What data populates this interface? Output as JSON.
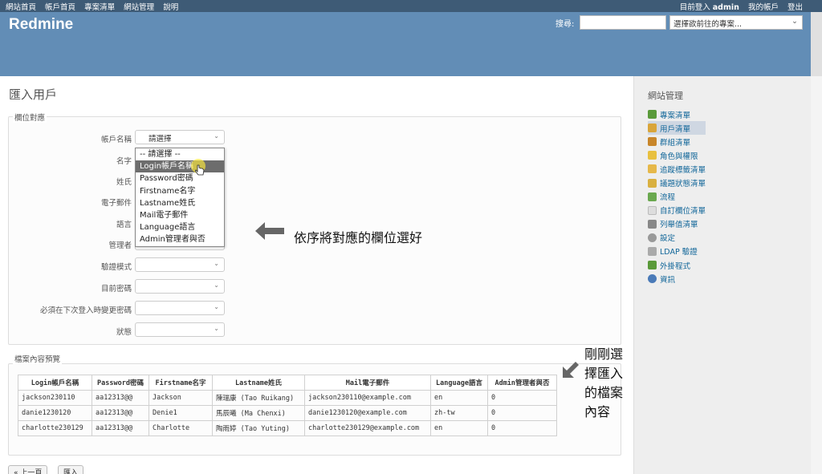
{
  "top_menu": {
    "left": [
      "網站首頁",
      "帳戶首頁",
      "專案清單",
      "網站管理",
      "說明"
    ],
    "logged_in_prefix": "目前登入",
    "user": "admin",
    "my_account": "我的帳戶",
    "logout": "登出"
  },
  "header": {
    "brand": "Redmine",
    "search_label": "搜尋:",
    "jump_placeholder": "選擇欲前往的專案..."
  },
  "page": {
    "title": "匯入用戶",
    "mapping_legend": "欄位對應",
    "preview_legend": "檔案內容預覽"
  },
  "fields": [
    {
      "label": "帳戶名稱",
      "value": "請選擇"
    },
    {
      "label": "名字",
      "value": ""
    },
    {
      "label": "姓氏",
      "value": ""
    },
    {
      "label": "電子郵件",
      "value": ""
    },
    {
      "label": "語言",
      "value": ""
    },
    {
      "label": "管理者",
      "value": ""
    },
    {
      "label": "驗證模式",
      "value": ""
    },
    {
      "label": "目前密碼",
      "value": ""
    },
    {
      "label": "必須在下次登入時變更密碼",
      "value": ""
    },
    {
      "label": "狀態",
      "value": ""
    }
  ],
  "dropdown_options": [
    "-- 請選擇 --",
    "Login帳戶名稱",
    "Password密碼",
    "Firstname名字",
    "Lastname姓氏",
    "Mail電子郵件",
    "Language語言",
    "Admin管理者與否"
  ],
  "dropdown_highlight": 1,
  "annotations": {
    "mapping_hint": "依序將對應的欄位選好",
    "preview_hint": "剛剛選擇匯入的檔案內容"
  },
  "preview": {
    "headers": [
      "Login帳戶名稱",
      "Password密碼",
      "Firstname名字",
      "Lastname姓氏",
      "Mail電子郵件",
      "Language語言",
      "Admin管理者與否"
    ],
    "rows": [
      [
        "jackson230110",
        "aa12313@@",
        "Jackson",
        "陳瑞康 (Tao Ruikang)",
        "jackson230110@example.com",
        "en",
        "0"
      ],
      [
        "danie1230120",
        "aa12313@@",
        "Denie1",
        "馬辰曦 (Ma Chenxi)",
        "danie1230120@example.com",
        "zh-tw",
        "0"
      ],
      [
        "charlotte230129",
        "aa12313@@",
        "Charlotte",
        "陶雨婷 (Tao Yuting)",
        "charlotte230129@example.com",
        "en",
        "0"
      ]
    ]
  },
  "buttons": {
    "back": "« 上一頁",
    "import": "匯入"
  },
  "sidebar": {
    "title": "網站管理",
    "items": [
      {
        "label": "專案清單",
        "color": "#5a9a3a"
      },
      {
        "label": "用戶清單",
        "color": "#d9a53a",
        "selected": true
      },
      {
        "label": "群組清單",
        "color": "#c8862a"
      },
      {
        "label": "角色與權限",
        "color": "#e8c040"
      },
      {
        "label": "追蹤標籤清單",
        "color": "#e6b84a"
      },
      {
        "label": "議題狀態清單",
        "color": "#d9b040"
      },
      {
        "label": "流程",
        "color": "#6aa84f"
      },
      {
        "label": "自訂欄位清單",
        "color": "#dddddd"
      },
      {
        "label": "列舉值清單",
        "color": "#888888"
      },
      {
        "label": "設定",
        "color": "#999999"
      },
      {
        "label": "LDAP 驗證",
        "color": "#aaaaaa"
      },
      {
        "label": "外掛程式",
        "color": "#5a9a3a"
      },
      {
        "label": "資訊",
        "color": "#4a7ab8"
      }
    ]
  }
}
